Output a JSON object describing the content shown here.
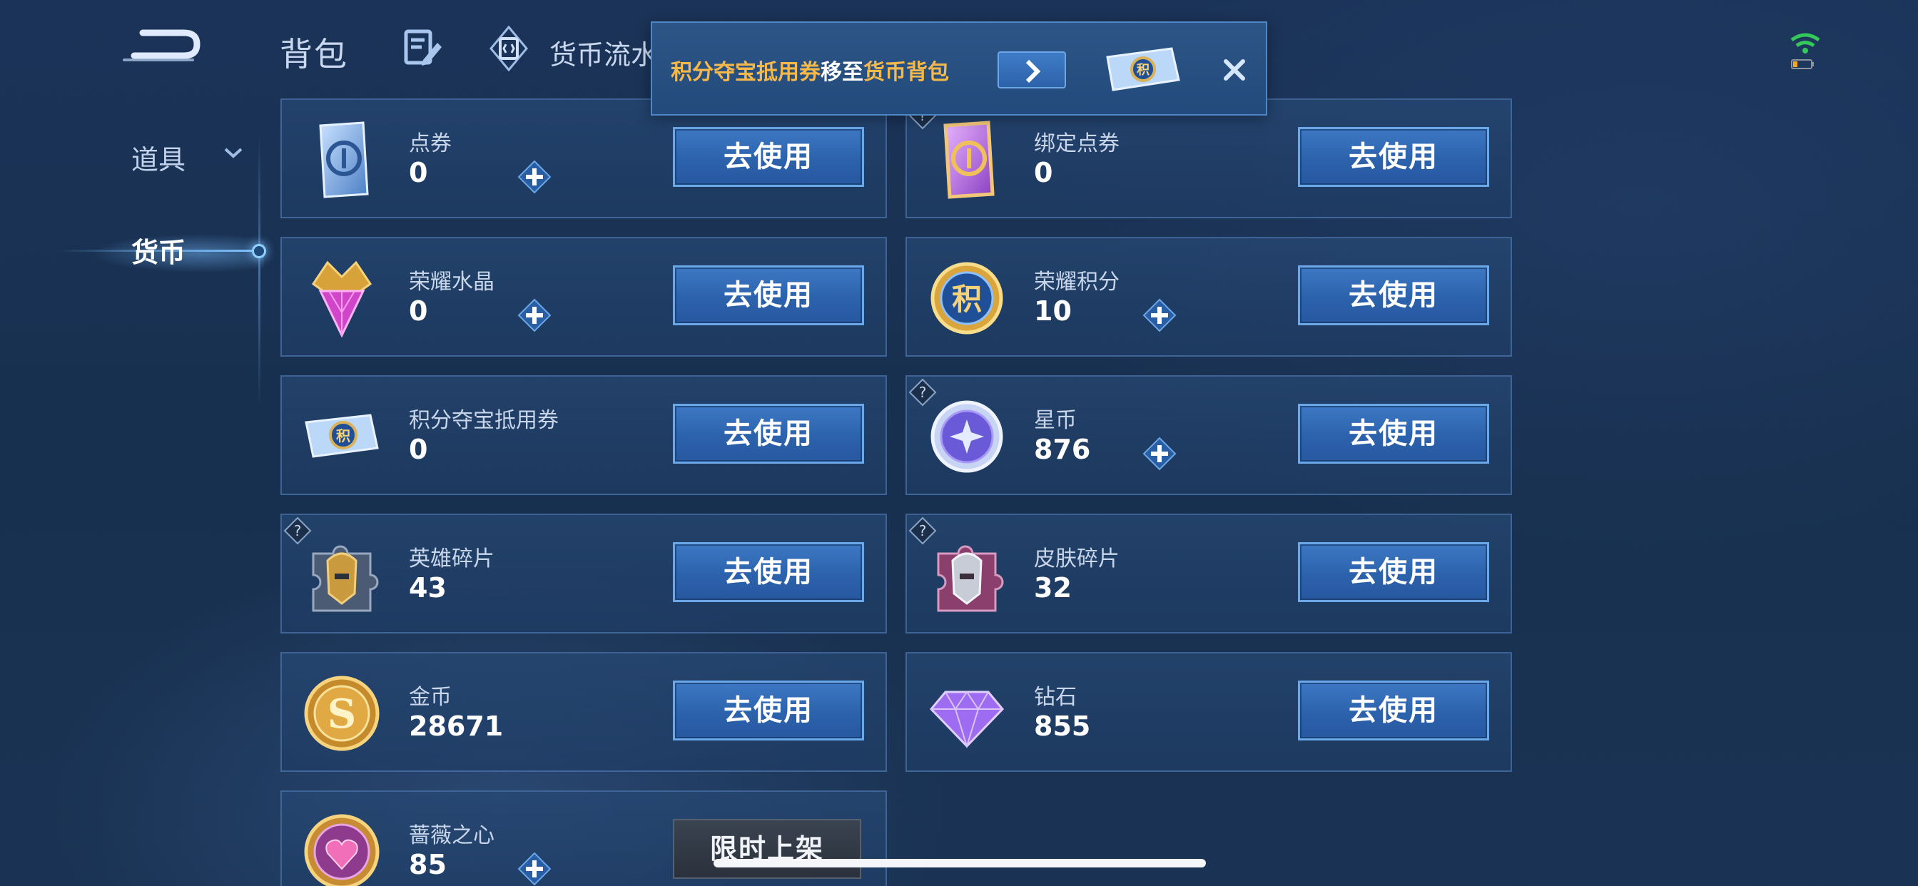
{
  "header": {
    "title": "背包",
    "flow_label": "货币流水"
  },
  "sidebar": {
    "items": [
      {
        "label": "道具",
        "active": false
      },
      {
        "label": "货币",
        "active": true
      }
    ]
  },
  "toast": {
    "item_name": "积分夺宝抵用券",
    "mid_text": "移至",
    "target": "货币背包"
  },
  "cards": [
    {
      "name": "点券",
      "amount": "0",
      "button": "去使用",
      "icon": "ticket-icon"
    },
    {
      "name": "绑定点券",
      "amount": "0",
      "button": "去使用",
      "icon": "bound-ticket-icon"
    },
    {
      "name": "荣耀水晶",
      "amount": "0",
      "button": "去使用",
      "icon": "crystal-icon"
    },
    {
      "name": "荣耀积分",
      "amount": "10",
      "button": "去使用",
      "icon": "points-coin-icon"
    },
    {
      "name": "积分夺宝抵用券",
      "amount": "0",
      "button": "去使用",
      "icon": "voucher-icon"
    },
    {
      "name": "星币",
      "amount": "876",
      "button": "去使用",
      "icon": "star-coin-icon"
    },
    {
      "name": "英雄碎片",
      "amount": "43",
      "button": "去使用",
      "icon": "hero-fragment-icon"
    },
    {
      "name": "皮肤碎片",
      "amount": "32",
      "button": "去使用",
      "icon": "skin-fragment-icon"
    },
    {
      "name": "金币",
      "amount": "28671",
      "button": "去使用",
      "icon": "gold-coin-icon"
    },
    {
      "name": "钻石",
      "amount": "855",
      "button": "去使用",
      "icon": "diamond-icon"
    },
    {
      "name": "蔷薇之心",
      "amount": "85",
      "button": "限时上架",
      "icon": "rose-heart-icon"
    }
  ],
  "colors": {
    "background": "#18304f",
    "button": "#2c62ac",
    "highlight": "#f5b84a",
    "wifi": "#34c759"
  }
}
